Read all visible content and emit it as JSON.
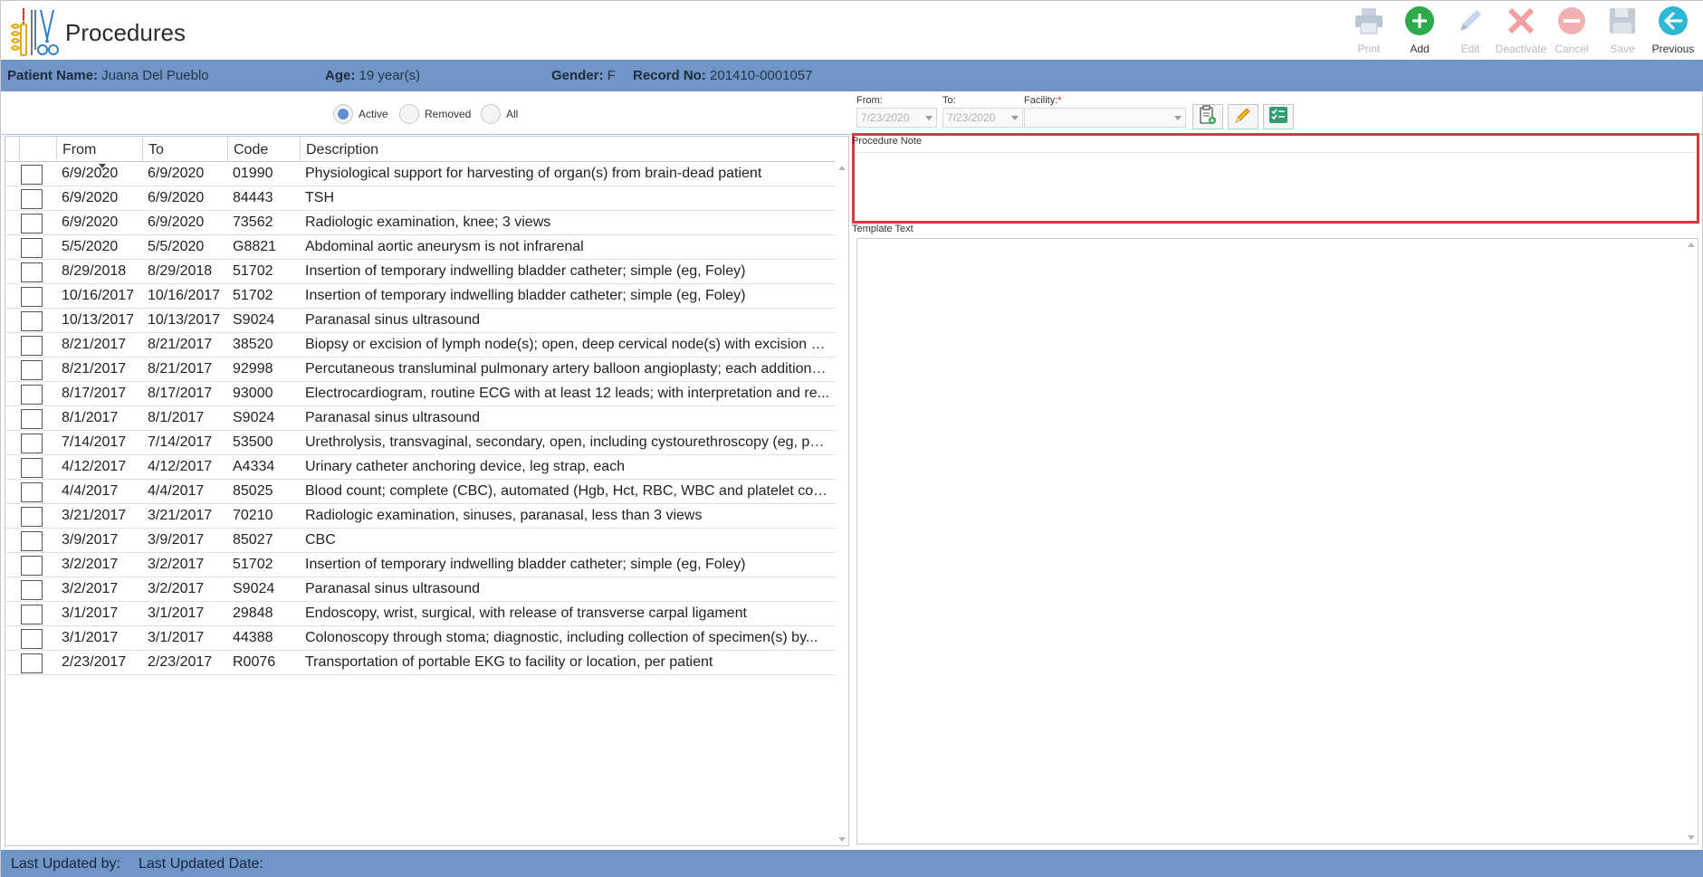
{
  "header": {
    "title": "Procedures"
  },
  "toolbar": {
    "print": {
      "label": "Print",
      "icon": "printer-icon",
      "enabled": false
    },
    "add": {
      "label": "Add",
      "icon": "plus-circle-icon",
      "enabled": true
    },
    "edit": {
      "label": "Edit",
      "icon": "pencil-icon",
      "enabled": false
    },
    "deactivate": {
      "label": "Deactivate",
      "icon": "x-icon",
      "enabled": false
    },
    "cancel": {
      "label": "Cancel",
      "icon": "minus-circle-icon",
      "enabled": false
    },
    "save": {
      "label": "Save",
      "icon": "floppy-icon",
      "enabled": false
    },
    "previous": {
      "label": "Previous",
      "icon": "arrow-left-circle-icon",
      "enabled": true
    }
  },
  "patient": {
    "name_label": "Patient Name:",
    "name": "Juana Del Pueblo",
    "age_label": "Age:",
    "age": "19 year(s)",
    "gender_label": "Gender:",
    "gender": "F",
    "record_label": "Record No:",
    "record": "201410-0001057"
  },
  "filters": {
    "status": [
      "Active",
      "Removed",
      "All"
    ],
    "selected": "Active",
    "from_label": "From:",
    "from_value": "7/23/2020",
    "to_label": "To:",
    "to_value": "7/23/2020",
    "facility_label": "Facility:",
    "facility_required": "*",
    "facility_value": ""
  },
  "grid": {
    "columns": [
      "From",
      "To",
      "Code",
      "Description"
    ],
    "rows": [
      {
        "from": "6/9/2020",
        "to": "6/9/2020",
        "code": "01990",
        "desc": "Physiological support for harvesting of organ(s) from brain-dead patient"
      },
      {
        "from": "6/9/2020",
        "to": "6/9/2020",
        "code": "84443",
        "desc": "TSH"
      },
      {
        "from": "6/9/2020",
        "to": "6/9/2020",
        "code": "73562",
        "desc": "Radiologic examination, knee; 3 views"
      },
      {
        "from": "5/5/2020",
        "to": "5/5/2020",
        "code": "G8821",
        "desc": "Abdominal aortic aneurysm is not infrarenal"
      },
      {
        "from": "8/29/2018",
        "to": "8/29/2018",
        "code": "51702",
        "desc": "Insertion of temporary indwelling bladder catheter; simple (eg, Foley)"
      },
      {
        "from": "10/16/2017",
        "to": "10/16/2017",
        "code": "51702",
        "desc": "Insertion of temporary indwelling bladder catheter; simple (eg, Foley)"
      },
      {
        "from": "10/13/2017",
        "to": "10/13/2017",
        "code": "S9024",
        "desc": "Paranasal sinus ultrasound"
      },
      {
        "from": "8/21/2017",
        "to": "8/21/2017",
        "code": "38520",
        "desc": "Biopsy or excision of lymph node(s); open, deep cervical node(s) with excision sc..."
      },
      {
        "from": "8/21/2017",
        "to": "8/21/2017",
        "code": "92998",
        "desc": "Percutaneous transluminal pulmonary artery balloon angioplasty; each additiona..."
      },
      {
        "from": "8/17/2017",
        "to": "8/17/2017",
        "code": "93000",
        "desc": "Electrocardiogram, routine ECG with at least 12 leads; with interpretation and re..."
      },
      {
        "from": "8/1/2017",
        "to": "8/1/2017",
        "code": "S9024",
        "desc": "Paranasal sinus ultrasound"
      },
      {
        "from": "7/14/2017",
        "to": "7/14/2017",
        "code": "53500",
        "desc": "Urethrolysis, transvaginal, secondary, open, including cystourethroscopy (eg, pos..."
      },
      {
        "from": "4/12/2017",
        "to": "4/12/2017",
        "code": "A4334",
        "desc": "Urinary catheter anchoring device, leg strap, each"
      },
      {
        "from": "4/4/2017",
        "to": "4/4/2017",
        "code": "85025",
        "desc": "Blood count; complete (CBC), automated (Hgb, Hct, RBC, WBC and platelet coun..."
      },
      {
        "from": "3/21/2017",
        "to": "3/21/2017",
        "code": "70210",
        "desc": "Radiologic examination, sinuses, paranasal, less than 3 views"
      },
      {
        "from": "3/9/2017",
        "to": "3/9/2017",
        "code": "85027",
        "desc": "CBC"
      },
      {
        "from": "3/2/2017",
        "to": "3/2/2017",
        "code": "51702",
        "desc": "Insertion of temporary indwelling bladder catheter; simple (eg, Foley)"
      },
      {
        "from": "3/2/2017",
        "to": "3/2/2017",
        "code": "S9024",
        "desc": "Paranasal sinus ultrasound"
      },
      {
        "from": "3/1/2017",
        "to": "3/1/2017",
        "code": "29848",
        "desc": "Endoscopy, wrist, surgical, with release of transverse carpal ligament"
      },
      {
        "from": "3/1/2017",
        "to": "3/1/2017",
        "code": "44388",
        "desc": "Colonoscopy through stoma; diagnostic, including collection of specimen(s) by..."
      },
      {
        "from": "2/23/2017",
        "to": "2/23/2017",
        "code": "R0076",
        "desc": "Transportation of portable EKG to facility or location, per patient"
      }
    ]
  },
  "panel": {
    "note_label": "Procedure Note",
    "template_label": "Template Text"
  },
  "footer": {
    "updated_by_label": "Last Updated by:",
    "updated_date_label": "Last Updated Date:"
  }
}
